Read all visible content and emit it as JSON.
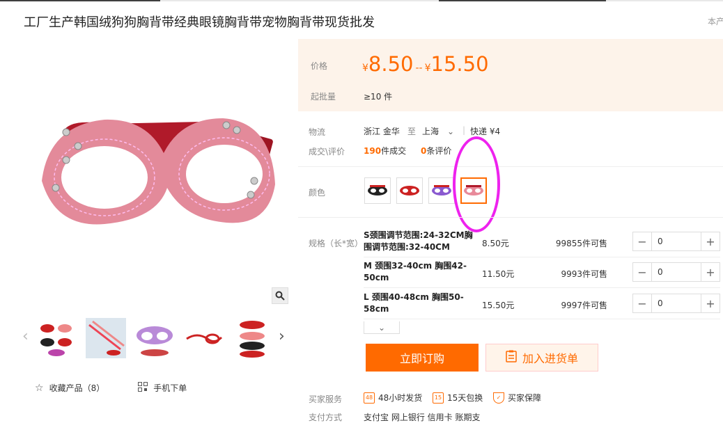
{
  "product": {
    "title": "工厂生产韩国绒狗狗胸背带经典眼镜胸背带宠物胸背带现货批发",
    "extra": "本产"
  },
  "price": {
    "label": "价格",
    "currency": "¥",
    "low": "8.50",
    "dash": "--",
    "high": "15.50",
    "moq_label": "起批量",
    "moq_value": "≥10 件"
  },
  "logistics": {
    "label": "物流",
    "from": "浙江 金华",
    "to_word": "至",
    "dest": "上海",
    "method": "快递",
    "fee": "¥4"
  },
  "deals": {
    "label": "成交\\评价",
    "count": "190",
    "count_unit": "件成交",
    "reviews": "0",
    "reviews_unit": "条评价"
  },
  "color": {
    "label": "颜色",
    "selected_index": 3
  },
  "specs": {
    "label": "规格（长*宽）",
    "rows": [
      {
        "name": "S颈围调节范围:24-32CM胸围调节范围:32-40CM",
        "price": "8.50元",
        "stock": "99855件可售",
        "qty": "0"
      },
      {
        "name": "M 颈围32-40cm 胸围42-50cm",
        "price": "11.50元",
        "stock": "9993件可售",
        "qty": "0"
      },
      {
        "name": "L 颈围40-48cm 胸围50-58cm",
        "price": "15.50元",
        "stock": "9997件可售",
        "qty": "0"
      }
    ]
  },
  "buttons": {
    "buy_now": "立即订购",
    "add_cart": "加入进货单"
  },
  "gallery": {
    "favorite": "收藏产品（8）",
    "mobile": "手机下单"
  },
  "services": {
    "label": "买家服务",
    "items": [
      "48小时发货",
      "15天包换",
      "买家保障"
    ]
  },
  "payment": {
    "label": "支付方式",
    "items": "支付宝 网上银行 信用卡 账期支"
  },
  "colors": {
    "accent": "#ff6a00",
    "annotation": "#ee22ee"
  }
}
